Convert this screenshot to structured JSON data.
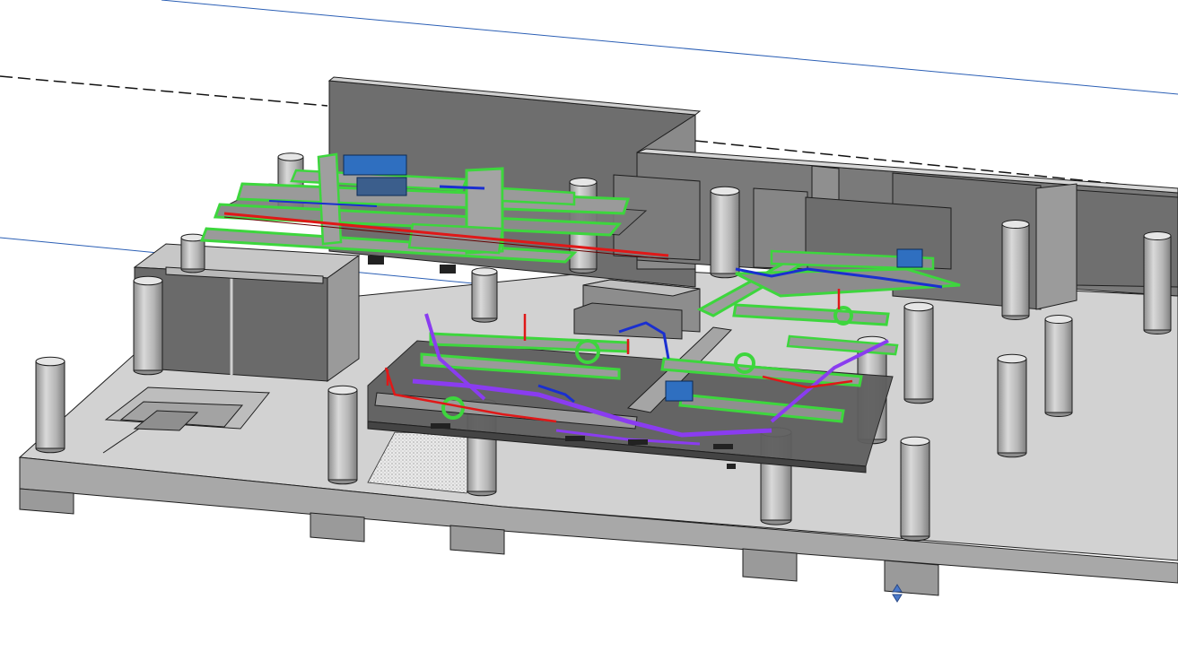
{
  "viewport": {
    "name": "3D model view",
    "kind": "bim-isometric",
    "background": "#ffffff"
  },
  "colors": {
    "slab_top": "#d2d2d2",
    "slab_face": "#a8a8a8",
    "beam_face": "#9a9a9a",
    "wall_dark": "#6e6e6e",
    "wall_mid": "#8a8a8a",
    "column_light": "#cfcfcf",
    "column_dark": "#8d8d8d",
    "edge": "#1e1e1e",
    "duct_green": "#3dd63d",
    "duct_green_edge": "#2a7a2a",
    "pipe_red": "#e01818",
    "pipe_blue": "#1a2fd0",
    "pipe_purple": "#8a3cf0",
    "equipment_blue": "#2f6fc0",
    "section_line": "#2b5fb5",
    "level_line": "#111111"
  },
  "mep_systems": [
    {
      "system": "supply-air-duct",
      "color": "#3dd63d"
    },
    {
      "system": "hot-water-pipe",
      "color": "#e01818"
    },
    {
      "system": "chilled-water-pipe",
      "color": "#1a2fd0"
    },
    {
      "system": "condensate-pipe",
      "color": "#8a3cf0"
    }
  ],
  "controls": {
    "view_scroll_control": "up-down-arrows-icon"
  }
}
